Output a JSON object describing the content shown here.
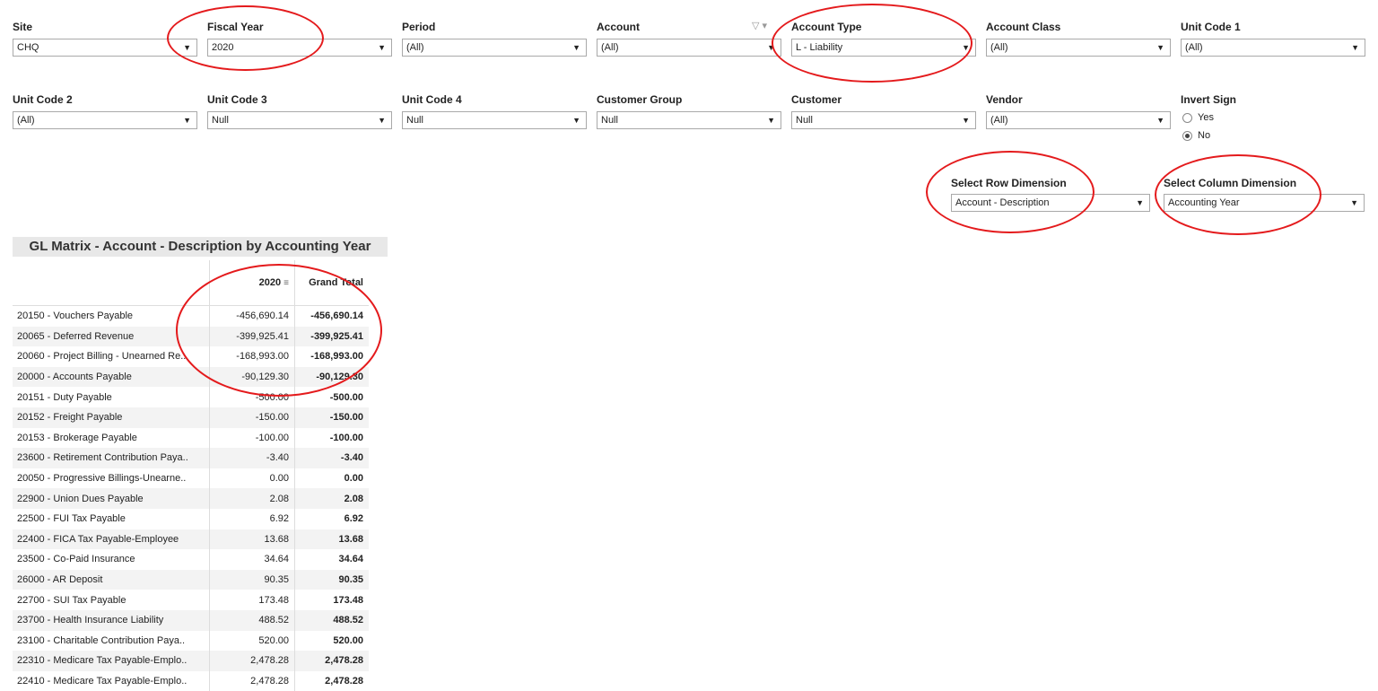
{
  "filters_row1": [
    {
      "label": "Site",
      "value": "CHQ"
    },
    {
      "label": "Fiscal Year",
      "value": "2020"
    },
    {
      "label": "Period",
      "value": "(All)"
    },
    {
      "label": "Account",
      "value": "(All)"
    },
    {
      "label": "Account Type",
      "value": "L - Liability"
    },
    {
      "label": "Account Class",
      "value": "(All)"
    },
    {
      "label": "Unit Code 1",
      "value": "(All)"
    }
  ],
  "filters_row2": [
    {
      "label": "Unit Code 2",
      "value": "(All)"
    },
    {
      "label": "Unit Code 3",
      "value": "Null"
    },
    {
      "label": "Unit Code 4",
      "value": "Null"
    },
    {
      "label": "Customer Group",
      "value": "Null"
    },
    {
      "label": "Customer",
      "value": "Null"
    },
    {
      "label": "Vendor",
      "value": "(All)"
    }
  ],
  "invert_sign": {
    "label": "Invert Sign",
    "options": [
      "Yes",
      "No"
    ],
    "selected": "No"
  },
  "row_dimension": {
    "label": "Select Row Dimension",
    "value": "Account - Description"
  },
  "column_dimension": {
    "label": "Select Column Dimension",
    "value": "Accounting Year"
  },
  "matrix": {
    "title": "GL Matrix  - Account - Description by Accounting Year",
    "col_year": "2020",
    "col_total": "Grand Total",
    "rows": [
      [
        "20150 - Vouchers Payable",
        "-456,690.14",
        "-456,690.14"
      ],
      [
        "20065 - Deferred Revenue",
        "-399,925.41",
        "-399,925.41"
      ],
      [
        "20060 - Project Billing - Unearned Re..",
        "-168,993.00",
        "-168,993.00"
      ],
      [
        "20000 - Accounts Payable",
        "-90,129.30",
        "-90,129.30"
      ],
      [
        "20151 - Duty Payable",
        "-500.00",
        "-500.00"
      ],
      [
        "20152 - Freight Payable",
        "-150.00",
        "-150.00"
      ],
      [
        "20153 - Brokerage Payable",
        "-100.00",
        "-100.00"
      ],
      [
        "23600 - Retirement Contribution Paya..",
        "-3.40",
        "-3.40"
      ],
      [
        "20050 - Progressive Billings-Unearne..",
        "0.00",
        "0.00"
      ],
      [
        "22900 - Union Dues Payable",
        "2.08",
        "2.08"
      ],
      [
        "22500 - FUI Tax Payable",
        "6.92",
        "6.92"
      ],
      [
        "22400 - FICA Tax Payable-Employee",
        "13.68",
        "13.68"
      ],
      [
        "23500 - Co-Paid Insurance",
        "34.64",
        "34.64"
      ],
      [
        "26000 - AR Deposit",
        "90.35",
        "90.35"
      ],
      [
        "22700 - SUI Tax Payable",
        "173.48",
        "173.48"
      ],
      [
        "23700 - Health Insurance Liability",
        "488.52",
        "488.52"
      ],
      [
        "23100 - Charitable Contribution Paya..",
        "520.00",
        "520.00"
      ],
      [
        "22310 - Medicare Tax Payable-Emplo..",
        "2,478.28",
        "2,478.28"
      ],
      [
        "22410 - Medicare Tax Payable-Emplo..",
        "2,478.28",
        "2,478.28"
      ]
    ]
  }
}
